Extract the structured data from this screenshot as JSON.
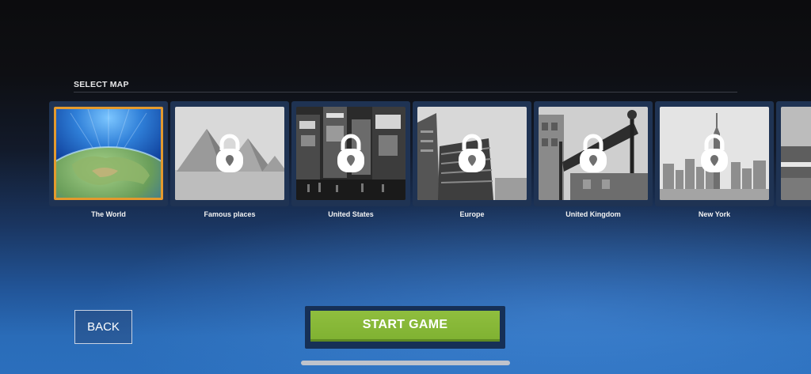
{
  "section_title": "SELECT MAP",
  "maps": [
    {
      "label": "The World",
      "locked": false,
      "selected": true
    },
    {
      "label": "Famous places",
      "locked": true,
      "selected": false
    },
    {
      "label": "United States",
      "locked": true,
      "selected": false
    },
    {
      "label": "Europe",
      "locked": true,
      "selected": false
    },
    {
      "label": "United Kingdom",
      "locked": true,
      "selected": false
    },
    {
      "label": "New York",
      "locked": true,
      "selected": false
    },
    {
      "label": "",
      "locked": true,
      "selected": false
    }
  ],
  "buttons": {
    "back_label": "BACK",
    "start_label": "START GAME"
  },
  "colors": {
    "selected_border": "#e49a2e",
    "start_button": "#85b536",
    "tile_frame": "#1f3353"
  }
}
